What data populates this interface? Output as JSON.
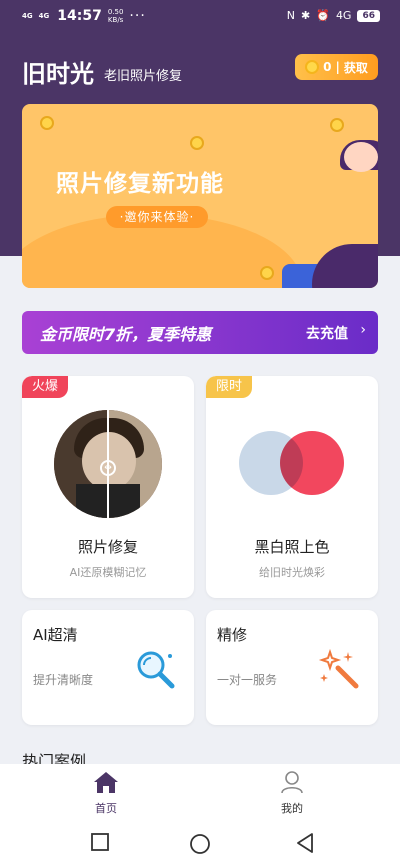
{
  "status_bar": {
    "signal_1": "4G",
    "signal_2": "4G",
    "time": "14:57",
    "speed_value": "0.50",
    "speed_unit": "KB/s",
    "more": "···",
    "network": "4G",
    "battery": "66"
  },
  "header": {
    "title": "旧时光",
    "subtitle": "老旧照片修复",
    "coin_count": "0",
    "coin_action": "获取"
  },
  "banner": {
    "title": "照片修复新功能",
    "subtitle": "·邀你来体验·"
  },
  "promo": {
    "text": "金币限时7折，夏季特惠",
    "cta": "去充值"
  },
  "cards": [
    {
      "tag": "火爆",
      "tag_color": "#f0445a",
      "title": "照片修复",
      "subtitle": "AI还原模糊记忆"
    },
    {
      "tag": "限时",
      "tag_color": "#f7c44a",
      "title": "黑白照上色",
      "subtitle": "给旧时光焕彩"
    },
    {
      "title": "AI超清",
      "subtitle": "提升清晰度",
      "icon": "magnifier-icon"
    },
    {
      "title": "精修",
      "subtitle": "一对一服务",
      "icon": "magic-wand-icon"
    }
  ],
  "section_title": "热门案例",
  "tabs": [
    {
      "label": "首页",
      "icon": "home-icon",
      "active": true
    },
    {
      "label": "我的",
      "icon": "user-icon",
      "active": false
    }
  ],
  "colors": {
    "header_bg": "#4b3566",
    "accent_purple": "#4b3566",
    "coin_orange": "#ff9c1f"
  }
}
